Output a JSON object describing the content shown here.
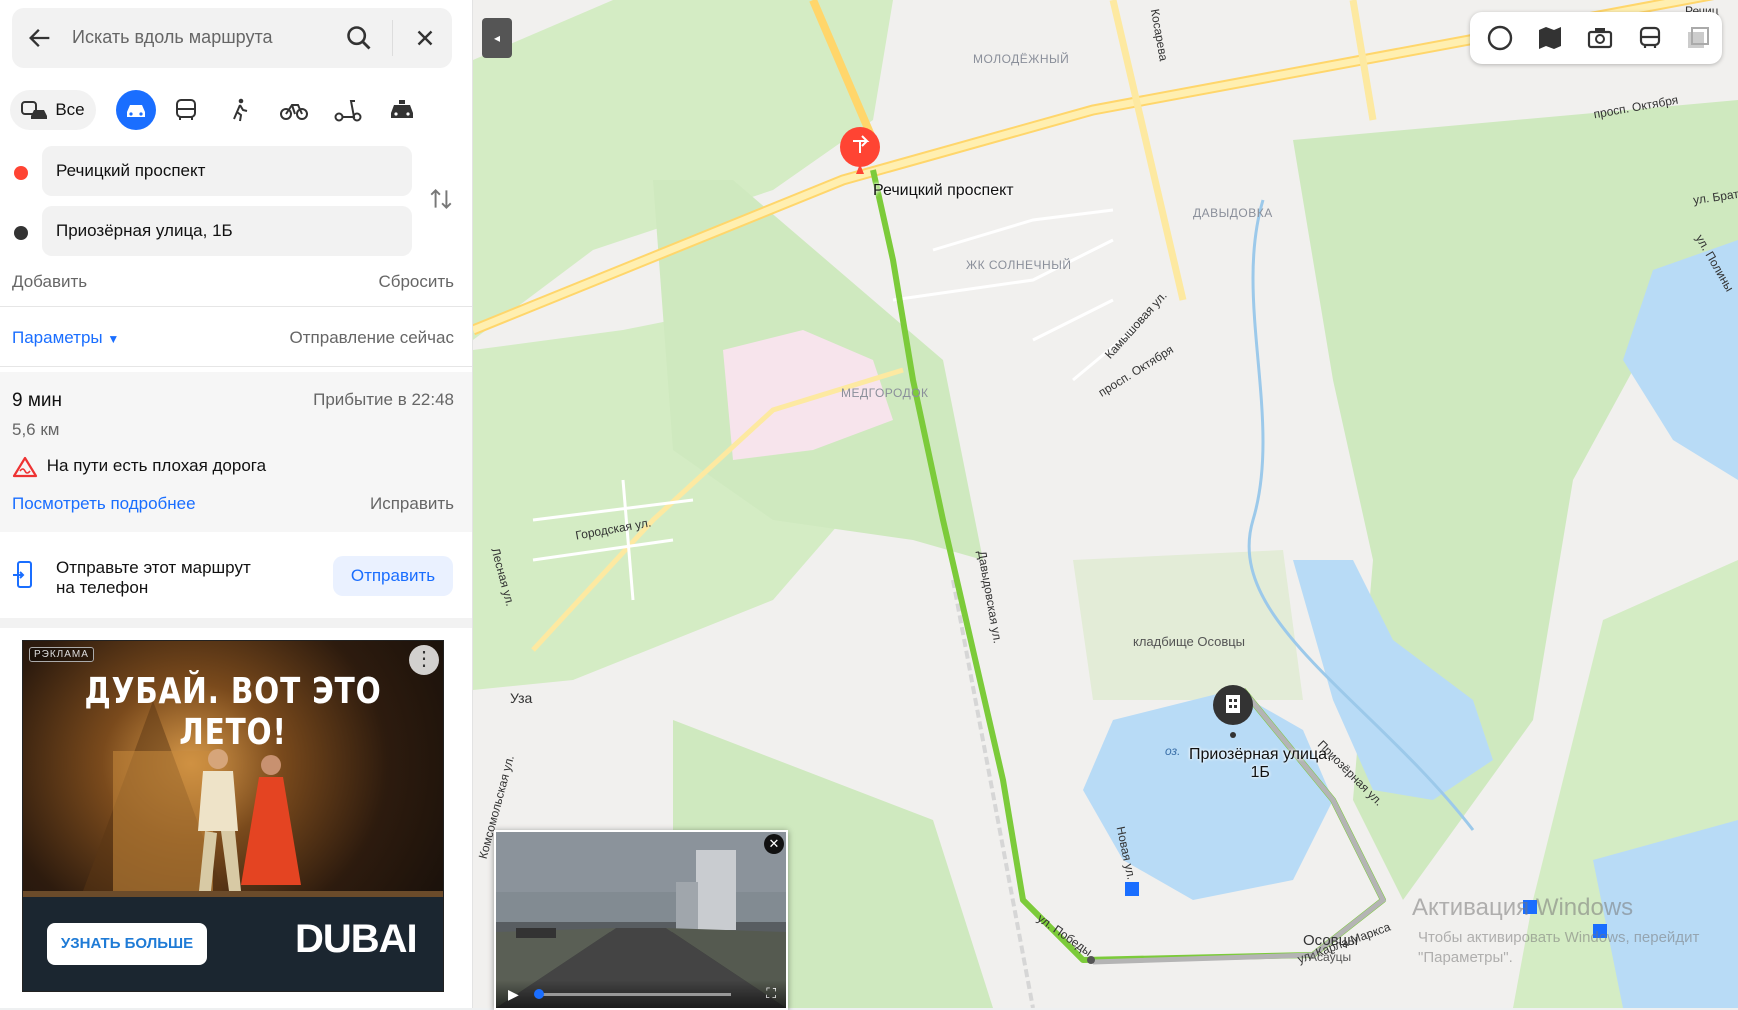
{
  "search": {
    "placeholder": "Искать вдоль маршрута"
  },
  "modes": {
    "all_label": "Все",
    "active": "car",
    "icons": [
      "car-icon",
      "bus-icon",
      "walk-icon",
      "bike-icon",
      "scooter-icon",
      "taxi-icon"
    ]
  },
  "route": {
    "from": "Речицкий проспект",
    "to": "Приозёрная улица, 1Б",
    "add_label": "Добавить",
    "reset_label": "Сбросить"
  },
  "params": {
    "label": "Параметры",
    "departure": "Отправление сейчас"
  },
  "result": {
    "duration": "9 мин",
    "arrival": "Прибытие в 22:48",
    "distance": "5,6 км",
    "warning": "На пути есть плохая дорога",
    "details_link": "Посмотреть подробнее",
    "fix_label": "Исправить"
  },
  "send_to_phone": {
    "text_line1": "Отправьте этот маршрут",
    "text_line2": "на телефон",
    "button": "Отправить"
  },
  "ad": {
    "badge": "РЭКЛАМА",
    "headline": "ДУБАЙ. ВОТ ЭТО ЛЕТО!",
    "cta": "УЗНАТЬ БОЛЬШЕ",
    "brand": "DUBAI"
  },
  "colors": {
    "accent": "#1a6eff",
    "route": "#7ccb3a",
    "start_dot": "#f43",
    "end_dot": "#333",
    "water": "#b8dbf6",
    "forest": "#cfeac0"
  },
  "map": {
    "place_labels": [
      "МОЛОДЁЖНЫЙ",
      "ДАВЫДОВКА",
      "ЖК СОЛНЕЧНЫЙ",
      "МЕДГОРОДОК"
    ],
    "street_labels": [
      "Косарева",
      "просп. Октября",
      "Речиц",
      "ул. Брат",
      "ул. Полины",
      "Камышовая ул.",
      "просп. Октября",
      "Городская ул.",
      "Лесная ул.",
      "Давыдовская ул.",
      "Комсомольская ул.",
      "Новая ул.",
      "ул. Победы",
      "Приозёрная ул.",
      "ул. Карла Маркса",
      "оз."
    ],
    "poi_start": "Речицкий проспект",
    "poi_end_line1": "Приозёрная улица,",
    "poi_end_line2": "1Б",
    "cemetery": "кладбище Осовцы",
    "village": "Уза",
    "osovtsy": "Осовцы",
    "osovtsy_by": "Асаўцы",
    "watermark": "Активация Windows",
    "watermark_sub1": "Чтобы активировать Windows, перейдит",
    "watermark_sub2": "\"Параметры\"."
  }
}
